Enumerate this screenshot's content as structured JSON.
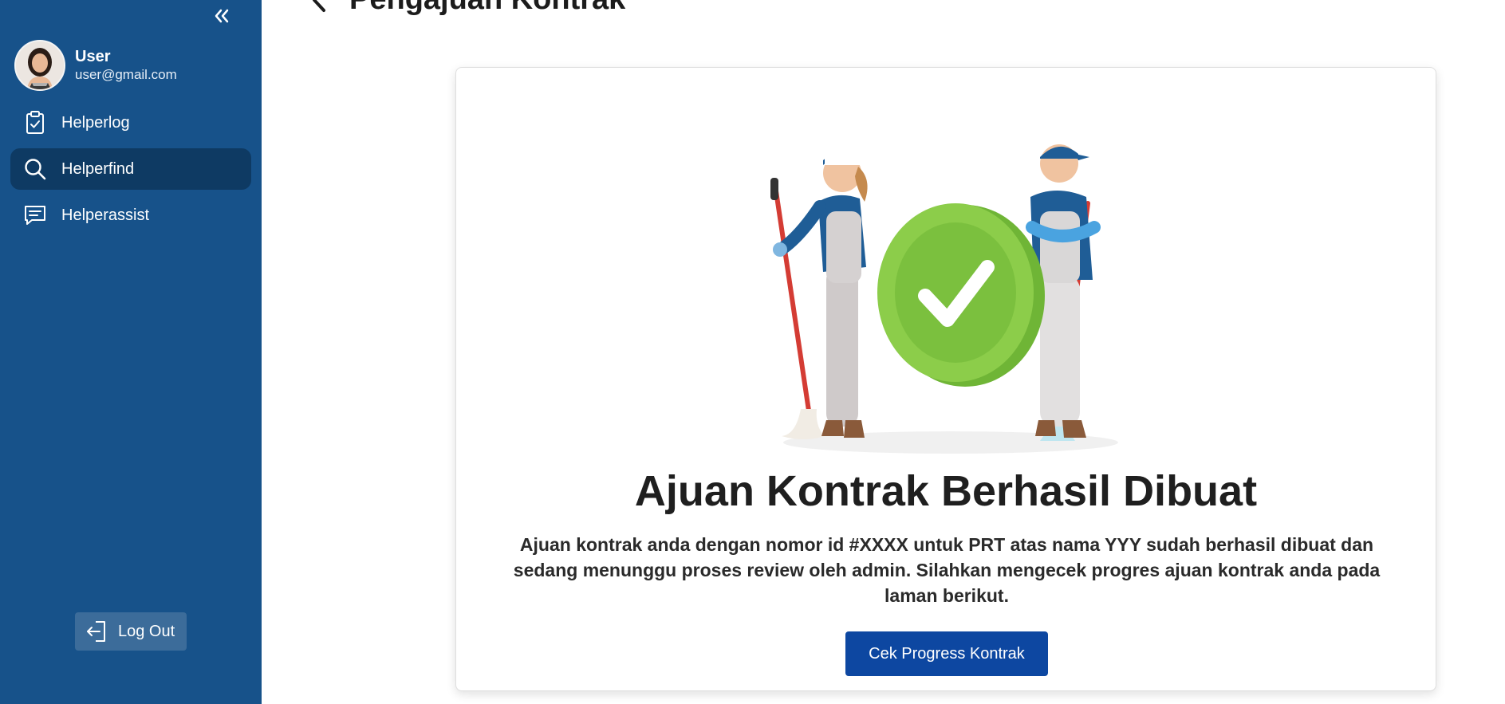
{
  "sidebar": {
    "user": {
      "name": "User",
      "email": "user@gmail.com"
    },
    "items": [
      {
        "label": "Helperlog",
        "icon": "clipboard-check-icon",
        "active": false
      },
      {
        "label": "Helperfind",
        "icon": "search-icon",
        "active": true
      },
      {
        "label": "Helperassist",
        "icon": "chat-icon",
        "active": false
      }
    ],
    "logout_label": "Log Out",
    "colors": {
      "background": "#17528a",
      "active": "#0e3a63",
      "logout": "#3c6c9a"
    }
  },
  "header": {
    "title": "Pengajuan Kontrak"
  },
  "main": {
    "title": "Ajuan Kontrak Berhasil Dibuat",
    "description": "Ajuan kontrak anda dengan nomor id #XXXX untuk PRT atas nama YYY sudah berhasil dibuat dan sedang menunggu proses review oleh admin. Silahkan mengecek progres ajuan kontrak anda pada laman berikut.",
    "button_label": "Cek Progress Kontrak",
    "colors": {
      "button": "#0d47a1",
      "check_badge": "#8ccd4a"
    }
  }
}
